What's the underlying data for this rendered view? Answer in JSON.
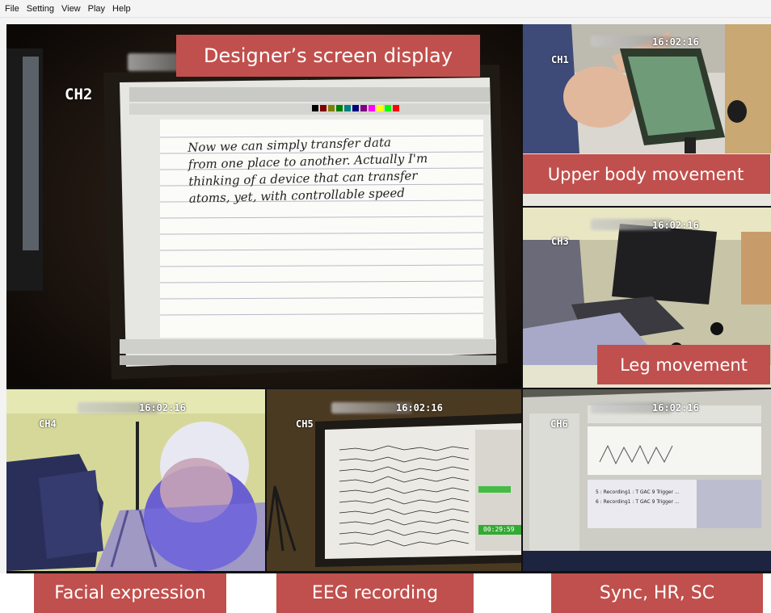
{
  "menu": {
    "items": [
      "File",
      "Setting",
      "View",
      "Play",
      "Help"
    ]
  },
  "channels": {
    "ch2": {
      "label": "CH2"
    },
    "ch1": {
      "label": "CH1",
      "time": "16:02:16"
    },
    "ch3": {
      "label": "CH3",
      "time": "16:02:16"
    },
    "ch4": {
      "label": "CH4",
      "time": "16:02:16"
    },
    "ch5": {
      "label": "CH5",
      "time": "16:02:16"
    },
    "ch6": {
      "label": "CH6",
      "time": "16:02:16"
    }
  },
  "captions": {
    "screen": "Designer’s screen display",
    "upper_body": "Upper body movement",
    "leg": "Leg movement",
    "facial": "Facial expression",
    "eeg": "EEG recording",
    "sync": "Sync,  HR, SC"
  },
  "handwriting": {
    "lines": [
      "Now we can simply transfer data",
      "from one place to another. Actually I'm",
      "thinking of a device that can transfer",
      "atoms, yet, with controllable speed"
    ]
  },
  "sync_list": {
    "rows": [
      "5 : Recording1 : T GAC 9 Trigger ...",
      "6 : Recording1 : T GAC 9 Trigger ..."
    ]
  },
  "eeg_status": {
    "value": "00:29:59"
  },
  "colors": {
    "caption_bg": "#c0504d",
    "caption_text": "#ffffff",
    "menubar_bg": "#f4f4f4"
  }
}
